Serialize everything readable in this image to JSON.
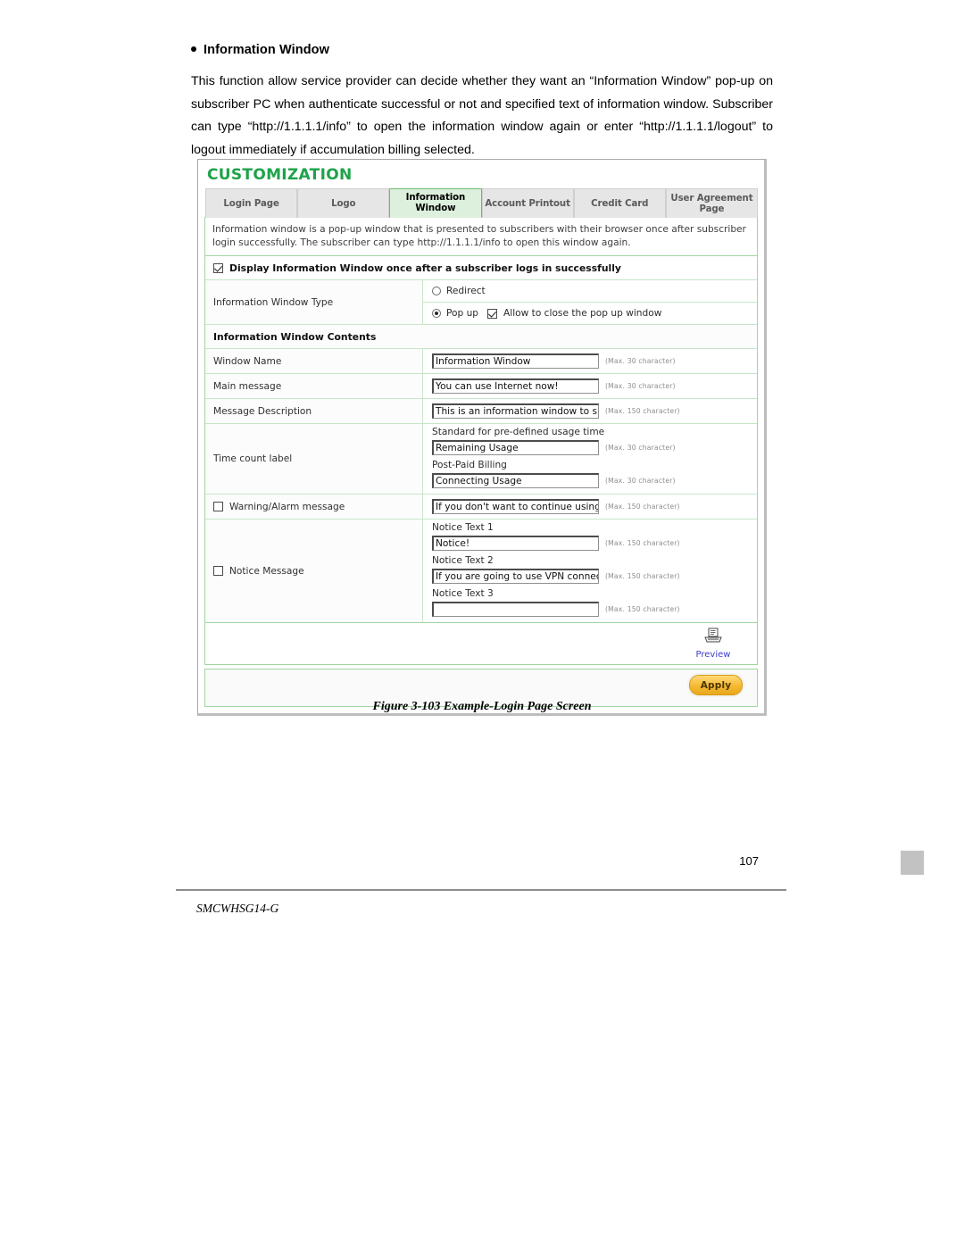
{
  "document": {
    "section_heading": "Information Window",
    "paragraph": "This function allow service provider can decide whether they want an “Information Window” pop-up on subscriber PC when authenticate successful or not and specified text of information window. Subscriber can type “http://1.1.1.1/info” to open the information window again or enter “http://1.1.1.1/logout” to logout immediately if accumulation billing selected.",
    "figure_caption": "Figure 3-103 Example-Login Page Screen",
    "page_number": "107",
    "footer_text": "SMCWHSG14-G"
  },
  "screenshot": {
    "title": "CUSTOMIZATION",
    "accent_color": "#1ea34a",
    "tabs": [
      {
        "label": "Login Page",
        "active": false
      },
      {
        "label": "Logo",
        "active": false
      },
      {
        "label": "Information Window",
        "active": true
      },
      {
        "label": "Account Printout",
        "active": false
      },
      {
        "label": "Credit Card",
        "active": false
      },
      {
        "label": "User Agreement Page",
        "active": false
      }
    ],
    "description": "Information window is a pop-up window that is presented to subscribers with their browser once after subscriber login successfully. The subscriber can type http://1.1.1.1/info to open this window again.",
    "display_toggle": {
      "label": "Display Information Window once after a subscriber logs in successfully",
      "checked": true
    },
    "window_type": {
      "row_label": "Information Window Type",
      "redirect_label": "Redirect",
      "redirect_selected": false,
      "popup_label": "Pop up",
      "popup_selected": true,
      "allow_close_label": "Allow to close the pop up window",
      "allow_close_checked": true
    },
    "contents_banner": "Information Window Contents",
    "fields": [
      {
        "label": "Window Name",
        "value": "Information Window",
        "hint": "(Max. 30 character)"
      },
      {
        "label": "Main message",
        "value": "You can use Internet now!",
        "hint": "(Max. 30 character)"
      },
      {
        "label": "Message Description",
        "value": "This is an information window to sho",
        "hint": "(Max. 150 character)"
      }
    ],
    "time_count": {
      "label": "Time count label",
      "entries": [
        {
          "sublabel": "Standard for pre-defined usage time",
          "value": "Remaining Usage",
          "hint": "(Max. 30 character)"
        },
        {
          "sublabel": "Post-Paid Billing",
          "value": "Connecting Usage",
          "hint": "(Max. 30 character)"
        }
      ]
    },
    "warning": {
      "label": "Warning/Alarm message",
      "checked": false,
      "value": "If you don't want to continue using In",
      "hint": "(Max. 150 character)"
    },
    "notice": {
      "label": "Notice Message",
      "checked": false,
      "entries": [
        {
          "sublabel": "Notice Text 1",
          "value": "Notice!",
          "hint": "(Max. 150 character)"
        },
        {
          "sublabel": "Notice Text 2",
          "value": "If you are going to use VPN connect",
          "hint": "(Max. 150 character)"
        },
        {
          "sublabel": "Notice Text 3",
          "value": "",
          "hint": "(Max. 150 character)"
        }
      ]
    },
    "preview_label": "Preview",
    "apply_label": "Apply"
  }
}
